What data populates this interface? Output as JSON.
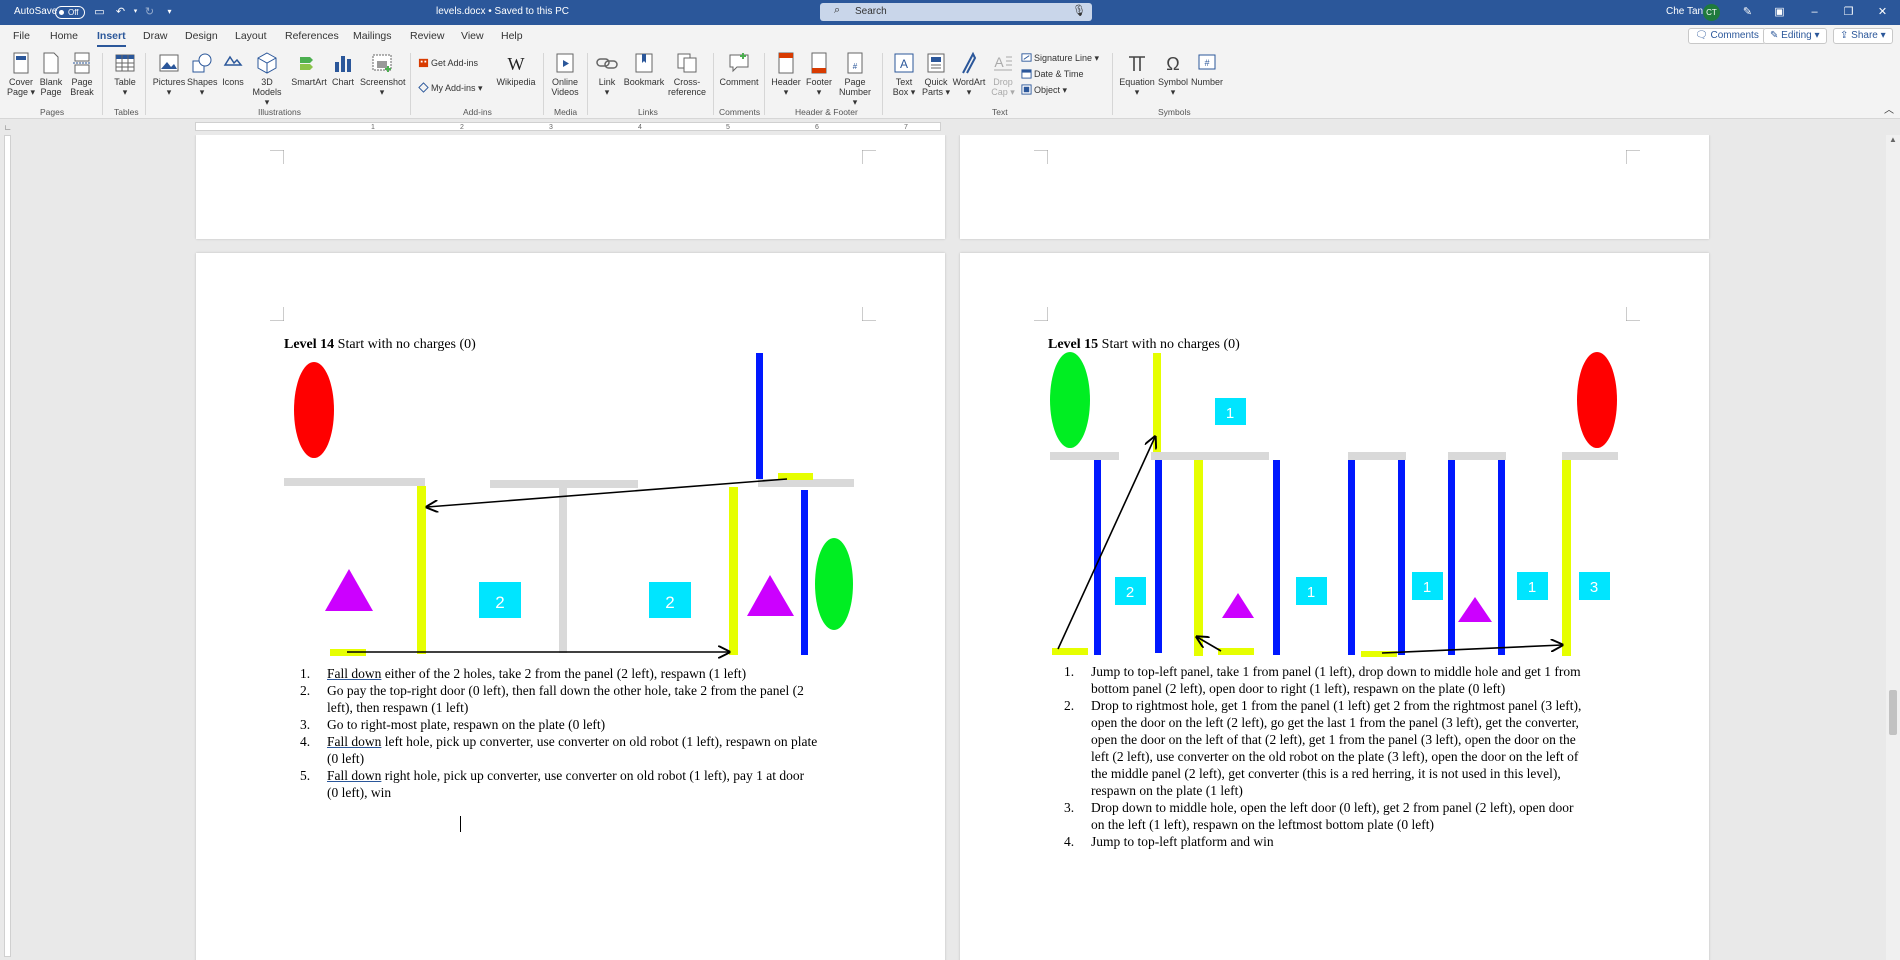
{
  "titlebar": {
    "autosave_label": "AutoSave",
    "autosave_state": "Off",
    "document_title": "levels.docx • Saved to this PC",
    "search_placeholder": "Search",
    "user_name": "Che Tan",
    "user_initials": "CT"
  },
  "tabs": [
    "File",
    "Home",
    "Insert",
    "Draw",
    "Design",
    "Layout",
    "References",
    "Mailings",
    "Review",
    "View",
    "Help"
  ],
  "active_tab": "Insert",
  "tab_actions": {
    "comments": "Comments",
    "editing": "Editing",
    "share": "Share"
  },
  "ribbon": {
    "pages": {
      "cover_page": [
        "Cover",
        "Page"
      ],
      "blank_page": [
        "Blank",
        "Page"
      ],
      "page_break": [
        "Page",
        "Break"
      ],
      "group": "Pages"
    },
    "tables": {
      "table": "Table",
      "group": "Tables"
    },
    "illustrations": {
      "pictures": "Pictures",
      "shapes": "Shapes",
      "icons": "Icons",
      "models": [
        "3D",
        "Models"
      ],
      "smartart": "SmartArt",
      "chart": "Chart",
      "screenshot": "Screenshot",
      "group": "Illustrations"
    },
    "addins": {
      "get_addins": "Get Add-ins",
      "my_addins": "My Add-ins",
      "wikipedia": "Wikipedia",
      "group": "Add-ins"
    },
    "media": {
      "online_videos": [
        "Online",
        "Videos"
      ],
      "group": "Media"
    },
    "links": {
      "link": "Link",
      "bookmark": "Bookmark",
      "crossref": [
        "Cross-",
        "reference"
      ],
      "group": "Links"
    },
    "comments": {
      "comment": "Comment",
      "group": "Comments"
    },
    "header_footer": {
      "header": "Header",
      "footer": "Footer",
      "page_number": [
        "Page",
        "Number"
      ],
      "group": "Header & Footer"
    },
    "text": {
      "text_box": [
        "Text",
        "Box"
      ],
      "quick_parts": [
        "Quick",
        "Parts"
      ],
      "wordart": "WordArt",
      "drop_cap": [
        "Drop",
        "Cap"
      ],
      "signature_line": "Signature Line",
      "date_time": "Date & Time",
      "object": "Object",
      "group": "Text"
    },
    "symbols": {
      "equation": "Equation",
      "symbol": "Symbol",
      "number": "Number",
      "group": "Symbols"
    }
  },
  "ruler_ticks": [
    "1",
    "2",
    "3",
    "4",
    "5",
    "6",
    "7"
  ],
  "colors": {
    "wall": "#d9d9d9",
    "charger": "#e6ff00",
    "door": "#0018ff",
    "panel": "#00ffff",
    "robot_red": "#ff0000",
    "robot_green": "#00ee22",
    "converter": "#cc00ff",
    "accent": "#2b579a"
  },
  "level14": {
    "heading": "Level 14",
    "subtitle": "Start with no charges (0)",
    "panels": [
      "2",
      "2"
    ],
    "steps": [
      [
        "Fall down",
        " either of the 2 holes, take 2 from the panel (2 left), respawn (1 left)"
      ],
      [
        "Go pay the top-right door (0 left), then fall down the other hole, take 2 from the panel (2",
        "left), then respawn (1 left)"
      ],
      [
        "Go to right-most plate, respawn on the plate (0 left)"
      ],
      [
        "Fall down",
        " left hole, pick up converter, use converter on old robot (1 left), respawn on plate",
        "(0 left)"
      ],
      [
        "Fall down",
        " right hole, pick up converter, use converter on old robot (1 left), pay 1 at door",
        "(0 left), win"
      ]
    ]
  },
  "level15": {
    "heading": "Level 15",
    "subtitle": "Start with no charges (0)",
    "panels": [
      "1",
      "2",
      "1",
      "1",
      "1",
      "3"
    ],
    "steps": [
      [
        "Jump to top-left panel, take 1 from panel (1 left), drop down to middle hole and get 1 from",
        "bottom panel (2 left), open door to right (1 left), respawn on the plate (0 left)"
      ],
      [
        "Drop to rightmost hole, get 1 from the panel (1 left) get 2 from the rightmost panel (3 left),",
        "open the door on the left (2 left), go get the last 1 from the panel (3 left), get the converter,",
        "open the door on the left of that (2 left), get 1 from the panel (3 left), open the door on the",
        "left (2 left), use converter on the old robot on the plate (3 left), open the door on the left of",
        "the middle panel (2 left), get converter (this is a red herring, it is not used in this level),",
        "respawn on the plate (1 left)"
      ],
      [
        "Drop down to middle hole, open the left door (0 left), get 2 from panel (2 left), open door",
        "on the left (1 left), respawn on the leftmost bottom plate (0 left)"
      ],
      [
        "Jump to top-left platform and win"
      ]
    ]
  }
}
